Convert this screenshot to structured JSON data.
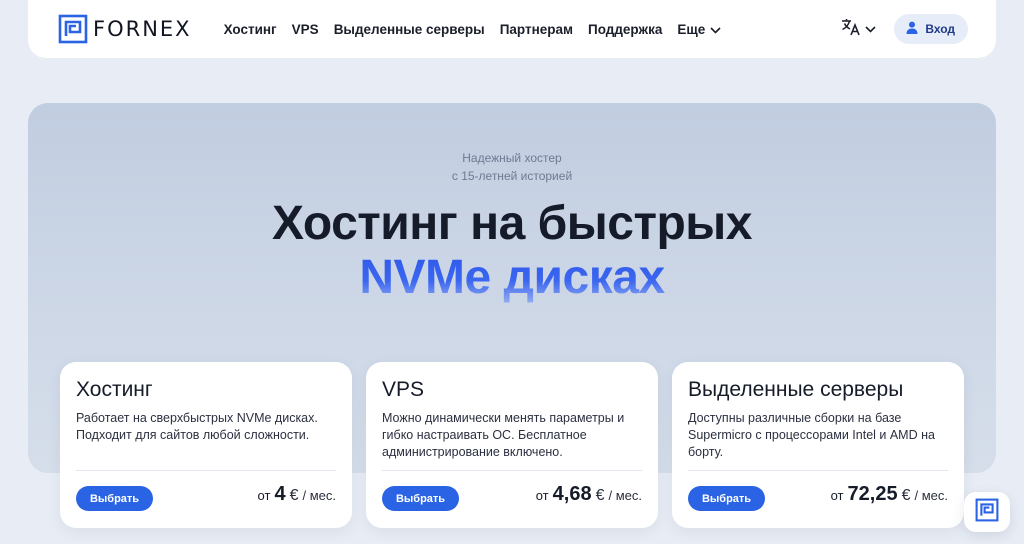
{
  "brand": {
    "name": "FORNEX",
    "logo_icon": "fornex-logo-icon",
    "accent_color": "#2a63e4"
  },
  "nav": {
    "items": [
      "Хостинг",
      "VPS",
      "Выделенные серверы",
      "Партнерам",
      "Поддержка"
    ],
    "more_label": "Еще",
    "lang_icon": "translate-icon",
    "login_label": "Вход",
    "login_icon": "user-icon"
  },
  "hero": {
    "subtitle_line1": "Надежный хостер",
    "subtitle_line2": "с 15-летней историей",
    "title_line1": "Хостинг на быстрых",
    "title_line2": "NVMe дисках"
  },
  "cards": [
    {
      "title": "Хостинг",
      "desc": "Работает на сверхбыстрых NVMe дисках. Подходит для сайтов любой сложности.",
      "button": "Выбрать",
      "price_from": "от",
      "price": "4",
      "currency": "€",
      "per": "/ мес."
    },
    {
      "title": "VPS",
      "desc": "Можно динамически менять параметры и гибко настраивать ОС. Бесплатное администрирование включено.",
      "button": "Выбрать",
      "price_from": "от",
      "price": "4,68",
      "currency": "€",
      "per": "/ мес."
    },
    {
      "title": "Выделенные серверы",
      "desc": "Доступны различные сборки на базе Supermicro с процессорами Intel и AMD на борту.",
      "button": "Выбрать",
      "price_from": "от",
      "price": "72,25",
      "currency": "€",
      "per": "/ мес."
    }
  ],
  "chat": {
    "icon": "fornex-chat-icon"
  }
}
